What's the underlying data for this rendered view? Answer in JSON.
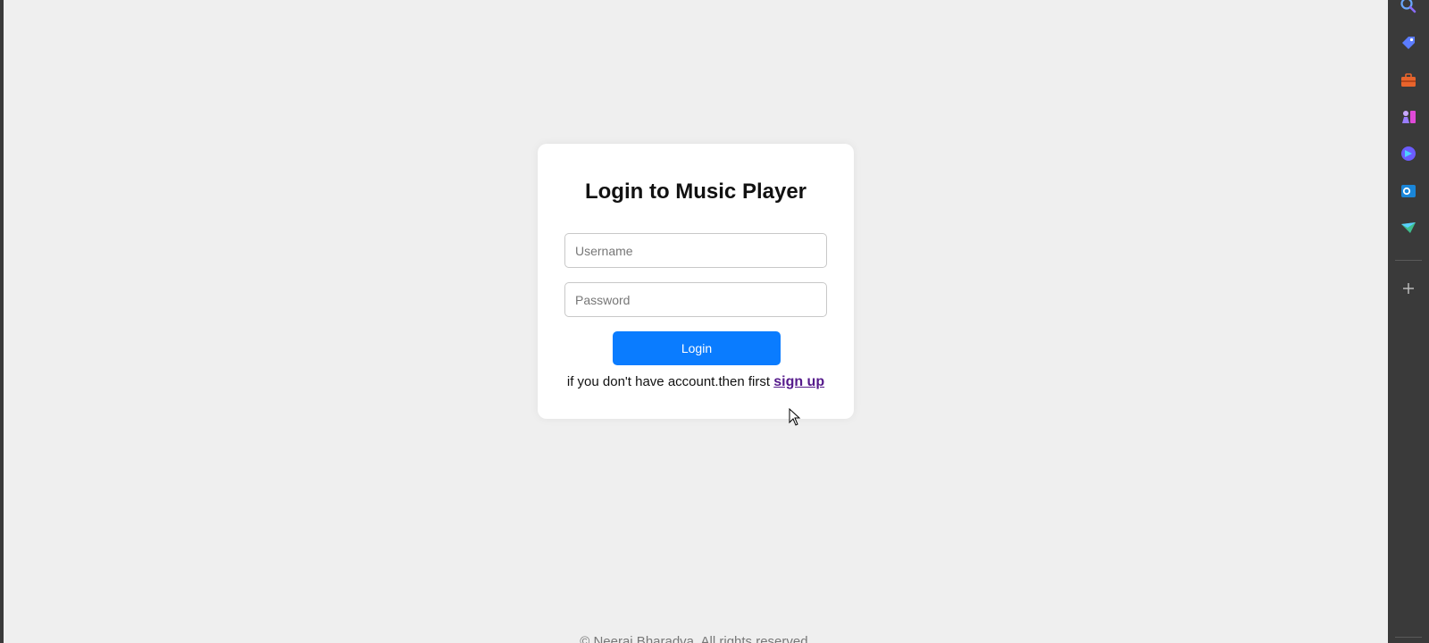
{
  "login": {
    "title": "Login to Music Player",
    "username_placeholder": "Username",
    "password_placeholder": "Password",
    "button_label": "Login",
    "signup_prompt": "if you don't have account.then first ",
    "signup_link": "sign up"
  },
  "footer": {
    "text": "© Neeraj Bharadva. All rights reserved."
  },
  "sidebar": {
    "icons": [
      "search-icon",
      "tag-icon",
      "toolbox-icon",
      "chess-icon",
      "copilot-icon",
      "outlook-icon",
      "send-icon",
      "plus-icon"
    ]
  },
  "colors": {
    "page_background": "#efefef",
    "card_background": "#ffffff",
    "button": "#0a7cff",
    "link": "#551a8b",
    "sidebar": "#3a3a3a"
  }
}
